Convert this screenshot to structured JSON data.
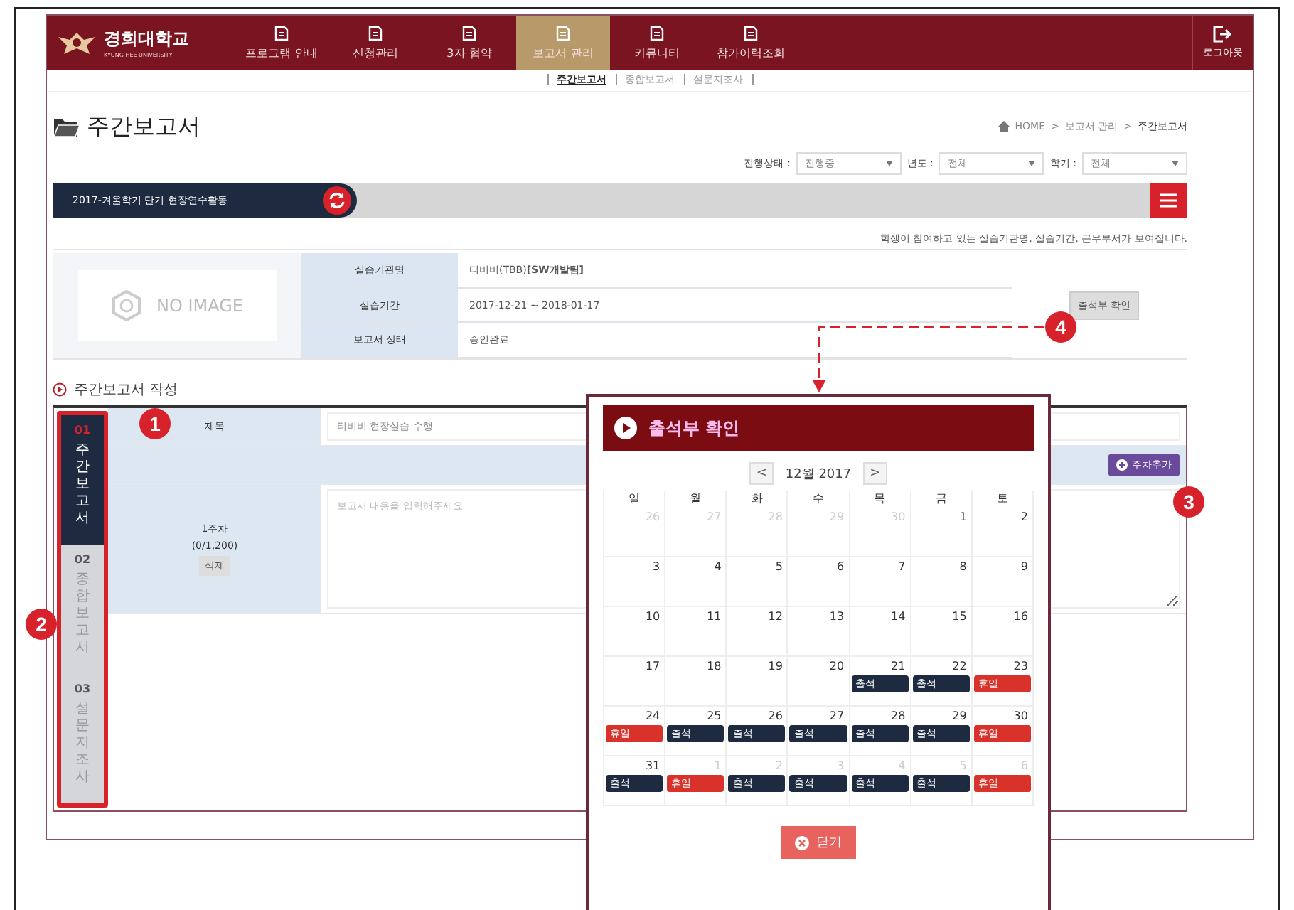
{
  "logo": {
    "name": "경희대학교",
    "subtitle": "KYUNG HEE UNIVERSITY"
  },
  "nav": [
    {
      "label": "프로그램 안내",
      "selected": false
    },
    {
      "label": "신청관리",
      "selected": false
    },
    {
      "label": "3자 협약",
      "selected": false
    },
    {
      "label": "보고서 관리",
      "selected": true
    },
    {
      "label": "커뮤니티",
      "selected": false
    },
    {
      "label": "참가이력조회",
      "selected": false
    }
  ],
  "logout": "로그아웃",
  "subnav": [
    {
      "label": "주간보고서",
      "selected": true
    },
    {
      "label": "종합보고서",
      "selected": false
    },
    {
      "label": "설문지조사",
      "selected": false
    }
  ],
  "page_title": "주간보고서",
  "breadcrumb": [
    "HOME",
    "보고서 관리",
    "주간보고서"
  ],
  "breadcrumb_separator": ">",
  "filters": [
    {
      "label": "진행상태 :",
      "value": "진행중"
    },
    {
      "label": "년도 :",
      "value": "전체"
    },
    {
      "label": "학기 :",
      "value": "전체"
    }
  ],
  "program_bar": {
    "title": "2017-겨울학기 단기 현장연수활동"
  },
  "notice": "학생이 참여하고 있는 실습기관명, 실습기간, 근무부서가 보여집니다.",
  "info": {
    "image_placeholder": "NO IMAGE",
    "rows": [
      {
        "label": "실습기관명",
        "value": "티비비(TBB)**[SW개발팀]**"
      },
      {
        "label": "실습기간",
        "value": "2017-12-21 ~ 2018-01-17"
      },
      {
        "label": "보고서 상태",
        "value": "승인완료"
      }
    ],
    "button": "출석부 확인"
  },
  "section_title": "주간보고서 작성",
  "side_tabs": [
    {
      "number": "01",
      "label": "주간보고서",
      "selected": true
    },
    {
      "number": "02",
      "label": "종합보고서",
      "selected": false
    },
    {
      "number": "03",
      "label": "설문지조사",
      "selected": false
    }
  ],
  "form": {
    "title_label": "제목",
    "title_value": "티비비 현장실습 수행",
    "add_button": "주차추가",
    "week": {
      "label": "1주차",
      "count": "(0/1,200)",
      "delete": "삭제",
      "placeholder": "보고서 내용을 입력해주세요"
    }
  },
  "callouts": [
    "1",
    "2",
    "3",
    "4"
  ],
  "popup": {
    "title": "출석부 확인",
    "prev": "<",
    "next": ">",
    "month": "12월 2017",
    "weekdays": [
      "일",
      "월",
      "화",
      "수",
      "목",
      "금",
      "토"
    ],
    "weeks": [
      [
        {
          "day": "26",
          "outside": true
        },
        {
          "day": "27",
          "outside": true
        },
        {
          "day": "28",
          "outside": true
        },
        {
          "day": "29",
          "outside": true
        },
        {
          "day": "30",
          "outside": true
        },
        {
          "day": "1",
          "outside": false
        },
        {
          "day": "2",
          "outside": false
        }
      ],
      [
        {
          "day": "3",
          "outside": false
        },
        {
          "day": "4",
          "outside": false
        },
        {
          "day": "5",
          "outside": false
        },
        {
          "day": "6",
          "outside": false
        },
        {
          "day": "7",
          "outside": false
        },
        {
          "day": "8",
          "outside": false
        },
        {
          "day": "9",
          "outside": false
        }
      ],
      [
        {
          "day": "10",
          "outside": false
        },
        {
          "day": "11",
          "outside": false
        },
        {
          "day": "12",
          "outside": false
        },
        {
          "day": "13",
          "outside": false
        },
        {
          "day": "14",
          "outside": false
        },
        {
          "day": "15",
          "outside": false
        },
        {
          "day": "16",
          "outside": false
        }
      ],
      [
        {
          "day": "17",
          "outside": false
        },
        {
          "day": "18",
          "outside": false
        },
        {
          "day": "19",
          "outside": false
        },
        {
          "day": "20",
          "outside": false
        },
        {
          "day": "21",
          "outside": false,
          "badge": {
            "text": "출석",
            "kind": "attend"
          }
        },
        {
          "day": "22",
          "outside": false,
          "badge": {
            "text": "출석",
            "kind": "attend"
          }
        },
        {
          "day": "23",
          "outside": false,
          "badge": {
            "text": "휴일",
            "kind": "holiday"
          }
        }
      ],
      [
        {
          "day": "24",
          "outside": false,
          "badge": {
            "text": "휴일",
            "kind": "holiday"
          }
        },
        {
          "day": "25",
          "outside": false,
          "badge": {
            "text": "출석",
            "kind": "attend"
          }
        },
        {
          "day": "26",
          "outside": false,
          "badge": {
            "text": "출석",
            "kind": "attend"
          }
        },
        {
          "day": "27",
          "outside": false,
          "badge": {
            "text": "출석",
            "kind": "attend"
          }
        },
        {
          "day": "28",
          "outside": false,
          "badge": {
            "text": "출석",
            "kind": "attend"
          }
        },
        {
          "day": "29",
          "outside": false,
          "badge": {
            "text": "출석",
            "kind": "attend"
          }
        },
        {
          "day": "30",
          "outside": false,
          "badge": {
            "text": "휴일",
            "kind": "holiday"
          }
        }
      ],
      [
        {
          "day": "31",
          "outside": false,
          "badge": {
            "text": "출석",
            "kind": "attend"
          }
        },
        {
          "day": "1",
          "outside": true,
          "badge": {
            "text": "휴일",
            "kind": "holiday"
          }
        },
        {
          "day": "2",
          "outside": true,
          "badge": {
            "text": "출석",
            "kind": "attend"
          }
        },
        {
          "day": "3",
          "outside": true,
          "badge": {
            "text": "출석",
            "kind": "attend"
          }
        },
        {
          "day": "4",
          "outside": true,
          "badge": {
            "text": "출석",
            "kind": "attend"
          }
        },
        {
          "day": "5",
          "outside": true,
          "badge": {
            "text": "출석",
            "kind": "attend"
          }
        },
        {
          "day": "6",
          "outside": true,
          "badge": {
            "text": "휴일",
            "kind": "holiday"
          }
        }
      ]
    ],
    "close": "닫기"
  }
}
